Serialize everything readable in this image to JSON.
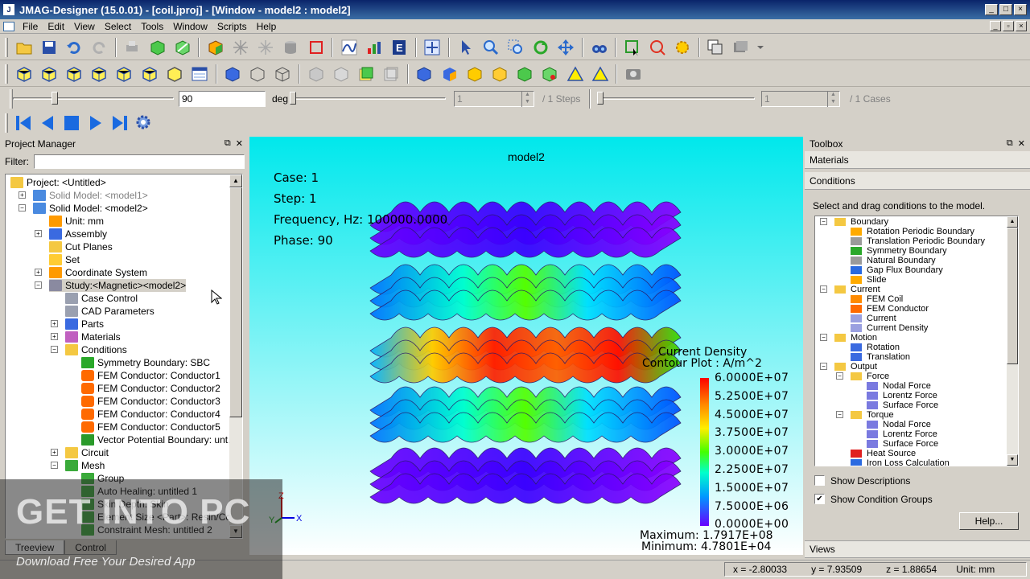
{
  "window": {
    "title": "JMAG-Designer (15.0.01) - [coil.jproj] - [Window - model2 : model2]"
  },
  "menu": [
    "File",
    "Edit",
    "View",
    "Select",
    "Tools",
    "Window",
    "Scripts",
    "Help"
  ],
  "slider_row": {
    "angle_value": "90",
    "angle_unit": "deg",
    "step_value": "1",
    "steps_label": "/ 1 Steps",
    "case_value": "1",
    "cases_label": "/ 1 Cases"
  },
  "project_manager": {
    "title": "Project Manager",
    "filter_label": "Filter:",
    "tree": [
      {
        "label": "Project: <Untitled>",
        "icon": "folder-icon",
        "gray": false
      },
      {
        "label": "Solid Model: <model1>",
        "icon": "model-icon",
        "gray": true
      },
      {
        "label": "Solid Model: <model2>",
        "icon": "model-icon",
        "gray": false
      },
      {
        "label": "Unit: mm",
        "icon": "unit-icon",
        "gray": false
      },
      {
        "label": "Assembly",
        "icon": "assembly-icon",
        "gray": false
      },
      {
        "label": "Cut Planes",
        "icon": "cutplane-icon",
        "gray": false
      },
      {
        "label": "Set",
        "icon": "set-icon",
        "gray": false
      },
      {
        "label": "Coordinate System",
        "icon": "coordinate-icon",
        "gray": false
      },
      {
        "label": "Study:<Magnetic><model2>",
        "icon": "study-icon",
        "gray": false
      },
      {
        "label": "Case Control",
        "icon": "table-icon",
        "gray": false
      },
      {
        "label": "CAD Parameters",
        "icon": "table-icon",
        "gray": false
      },
      {
        "label": "Parts",
        "icon": "parts-icon",
        "gray": false
      },
      {
        "label": "Materials",
        "icon": "materials-icon",
        "gray": false
      },
      {
        "label": "Conditions",
        "icon": "folder-icon",
        "gray": false
      },
      {
        "label": "Symmetry Boundary: SBC",
        "icon": "symmetry-icon",
        "gray": false
      },
      {
        "label": "FEM Conductor: Conductor1",
        "icon": "conductor-icon",
        "gray": false
      },
      {
        "label": "FEM Conductor: Conductor2",
        "icon": "conductor-icon",
        "gray": false
      },
      {
        "label": "FEM Conductor: Conductor3",
        "icon": "conductor-icon",
        "gray": false
      },
      {
        "label": "FEM Conductor: Conductor4",
        "icon": "conductor-icon",
        "gray": false
      },
      {
        "label": "FEM Conductor: Conductor5",
        "icon": "conductor-icon",
        "gray": false
      },
      {
        "label": "Vector Potential Boundary: unt…",
        "icon": "boundary-icon",
        "gray": false
      },
      {
        "label": "Circuit",
        "icon": "folder-icon",
        "gray": false
      },
      {
        "label": "Mesh",
        "icon": "mesh-icon",
        "gray": false
      },
      {
        "label": "Group",
        "icon": "mesh-icon",
        "gray": false
      },
      {
        "label": "Auto Healing: untitled 1",
        "icon": "mesh-icon",
        "gray": false
      },
      {
        "label": "Skin Depth: Skin",
        "icon": "mesh-icon",
        "gray": false
      },
      {
        "label": "Element Size <Part>: Resin/Coil",
        "icon": "mesh-icon",
        "gray": false
      },
      {
        "label": "Constraint Mesh: untitled 2",
        "icon": "mesh-icon",
        "gray": false
      }
    ],
    "tabs": [
      "Treeview",
      "Control"
    ]
  },
  "viewport": {
    "title": "model2",
    "case": "Case: 1",
    "step": "Step: 1",
    "frequency": "Frequency, Hz: 100000.0000",
    "phase": "Phase: 90",
    "legend_title1": "Current Density",
    "legend_title2": "Contour Plot : A/m^2",
    "legend_values": [
      "6.0000E+07",
      "5.2500E+07",
      "4.5000E+07",
      "3.7500E+07",
      "3.0000E+07",
      "2.2500E+07",
      "1.5000E+07",
      "7.5000E+06",
      "0.0000E+00"
    ],
    "maximum": "Maximum: 1.7917E+08",
    "minimum": "Minimum: 4.7801E+04",
    "axis_z": "Z",
    "axis_x": "X",
    "axis_y": "Y"
  },
  "toolbox": {
    "title": "Toolbox",
    "materials": "Materials",
    "conditions": "Conditions",
    "hint": "Select and drag conditions to the model.",
    "tree": [
      {
        "label": "Boundary",
        "icon": "folder-icon"
      },
      {
        "label": "Rotation Periodic Boundary",
        "icon": "rotation-periodic-icon"
      },
      {
        "label": "Translation Periodic Boundary",
        "icon": "translation-periodic-icon"
      },
      {
        "label": "Symmetry Boundary",
        "icon": "symmetry-icon"
      },
      {
        "label": "Natural Boundary",
        "icon": "natural-boundary-icon"
      },
      {
        "label": "Gap Flux Boundary",
        "icon": "gap-flux-icon"
      },
      {
        "label": "Slide",
        "icon": "slide-icon"
      },
      {
        "label": "Current",
        "icon": "folder-icon"
      },
      {
        "label": "FEM Coil",
        "icon": "coil-icon"
      },
      {
        "label": "FEM Conductor",
        "icon": "conductor-icon"
      },
      {
        "label": "Current",
        "icon": "current-icon"
      },
      {
        "label": "Current Density",
        "icon": "current-density-icon"
      },
      {
        "label": "Motion",
        "icon": "folder-icon"
      },
      {
        "label": "Rotation",
        "icon": "rotation-icon"
      },
      {
        "label": "Translation",
        "icon": "translation-icon"
      },
      {
        "label": "Output",
        "icon": "folder-icon"
      },
      {
        "label": "Force",
        "icon": "folder-icon"
      },
      {
        "label": "Nodal Force",
        "icon": "force-icon"
      },
      {
        "label": "Lorentz Force",
        "icon": "force-icon"
      },
      {
        "label": "Surface Force",
        "icon": "force-icon"
      },
      {
        "label": "Torque",
        "icon": "folder-icon"
      },
      {
        "label": "Nodal Force",
        "icon": "force-icon"
      },
      {
        "label": "Lorentz Force",
        "icon": "force-icon"
      },
      {
        "label": "Surface Force",
        "icon": "force-icon"
      },
      {
        "label": "Heat Source",
        "icon": "heat-source-icon"
      },
      {
        "label": "Iron Loss Calculation",
        "icon": "iron-loss-icon"
      }
    ],
    "show_descriptions": "Show Descriptions",
    "show_descriptions_checked": false,
    "show_condition_groups": "Show Condition Groups",
    "show_condition_groups_checked": true,
    "help": "Help...",
    "views": "Views"
  },
  "status": {
    "x": "x = -2.80033",
    "y": "y = 7.93509",
    "z": "z = 1.88654",
    "unit": "Unit: mm"
  },
  "watermark": {
    "big": "GET INTO PC",
    "small": "Download Free Your Desired App"
  },
  "colors": {
    "title_bar": "#0a246a",
    "viewport_top": "#00e8ec",
    "selection": "#d4d0c8"
  }
}
